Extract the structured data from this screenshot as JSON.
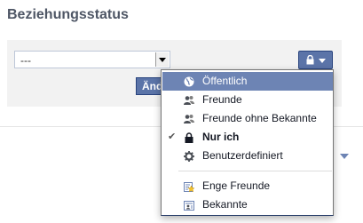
{
  "section": {
    "title": "Beziehungsstatus"
  },
  "relationship_select": {
    "value": "---"
  },
  "save_button": {
    "label": "Änderungen speichern"
  },
  "colors": {
    "accent": "#6d84b4",
    "button": "#5b74a8",
    "panel": "#f2f2f2"
  },
  "privacy_menu": {
    "items": [
      {
        "label": "Öffentlich",
        "icon": "globe-icon",
        "selected": true,
        "checked": false
      },
      {
        "label": "Freunde",
        "icon": "friends-icon",
        "selected": false,
        "checked": false
      },
      {
        "label": "Freunde ohne Bekannte",
        "icon": "friends-except-acquaintances-icon",
        "selected": false,
        "checked": false
      },
      {
        "label": "Nur ich",
        "icon": "lock-icon",
        "selected": false,
        "checked": true
      },
      {
        "label": "Benutzerdefiniert",
        "icon": "gear-icon",
        "selected": false,
        "checked": false
      }
    ],
    "lists": [
      {
        "label": "Enge Freunde",
        "icon": "star-list-icon"
      },
      {
        "label": "Bekannte",
        "icon": "acquaintances-list-icon"
      }
    ]
  }
}
